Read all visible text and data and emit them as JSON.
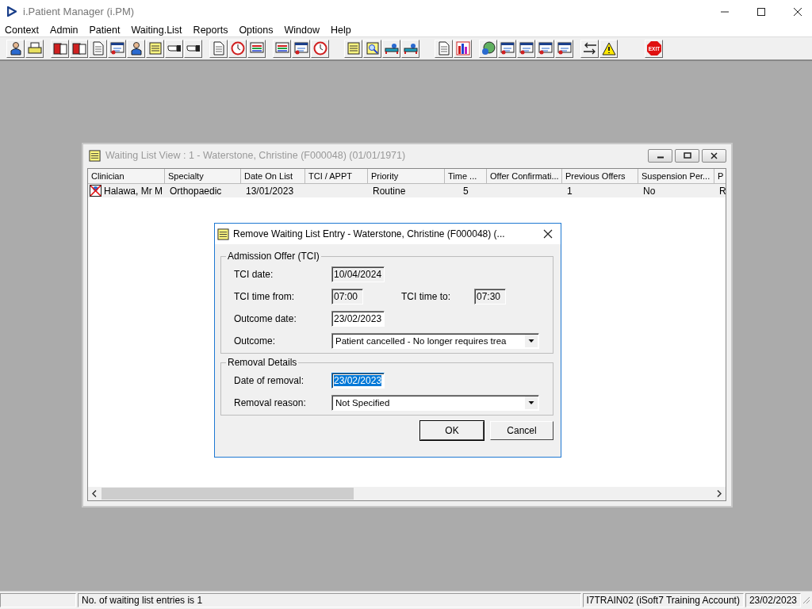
{
  "app": {
    "title": "i.Patient Manager (i.PM)"
  },
  "menu": [
    {
      "label": "Context"
    },
    {
      "label": "Admin"
    },
    {
      "label": "Patient"
    },
    {
      "label": "Waiting.List"
    },
    {
      "label": "Reports"
    },
    {
      "label": "Options"
    },
    {
      "label": "Window"
    },
    {
      "label": "Help"
    }
  ],
  "toolbar": {
    "exit_label": "EXIT"
  },
  "list_window": {
    "title": "Waiting List View :  1 - Waterstone, Christine (F000048) (01/01/1971)",
    "active": false,
    "columns": [
      "Clinician",
      "Specialty",
      "Date On List",
      "TCI / APPT",
      "Priority",
      "Time ...",
      "Offer Confirmati...",
      "Previous Offers",
      "Suspension Per...",
      "P"
    ],
    "rows": [
      {
        "cells": [
          "Halawa, Mr M",
          "Orthopaedic",
          "13/01/2023",
          "",
          "Routine",
          "5",
          "",
          "1",
          "No",
          "R"
        ]
      }
    ]
  },
  "dialog": {
    "title": "Remove Waiting List Entry - Waterstone, Christine (F000048) (...",
    "groups": [
      {
        "title": "Admission Offer (TCI)",
        "rows": [
          [
            {
              "label": "TCI date:",
              "field": {
                "kind": "text",
                "value": "10/04/2024",
                "readonly": true,
                "text_selected": false
              }
            }
          ],
          [
            {
              "label": "TCI time from:",
              "field": {
                "kind": "time",
                "value": "07:00",
                "readonly": true,
                "text_selected": false
              }
            },
            {
              "label": "TCI time to:",
              "field": {
                "kind": "time",
                "value": "07:30",
                "readonly": true,
                "text_selected": false
              }
            }
          ],
          [
            {
              "label": "Outcome date:",
              "field": {
                "kind": "text",
                "value": "23/02/2023",
                "readonly": false,
                "text_selected": false
              }
            }
          ],
          [
            {
              "label": "Outcome:",
              "field": {
                "kind": "combo",
                "value": "Patient cancelled - No longer requires trea",
                "readonly": false
              }
            }
          ]
        ]
      },
      {
        "title": "Removal Details",
        "rows": [
          [
            {
              "label": "Date of removal:",
              "field": {
                "kind": "text",
                "value": "23/02/2023",
                "readonly": false,
                "text_selected": true
              }
            }
          ],
          [
            {
              "label": "Removal reason:",
              "field": {
                "kind": "combo",
                "value": "Not Specified",
                "readonly": false
              }
            }
          ]
        ]
      }
    ],
    "buttons": [
      {
        "label": "OK",
        "default": true
      },
      {
        "label": "Cancel",
        "default": false
      }
    ]
  },
  "status_bar": [
    "No. of waiting list entries is 1",
    "I7TRAIN02 (iSoft7 Training Account)",
    "23/02/2023"
  ]
}
